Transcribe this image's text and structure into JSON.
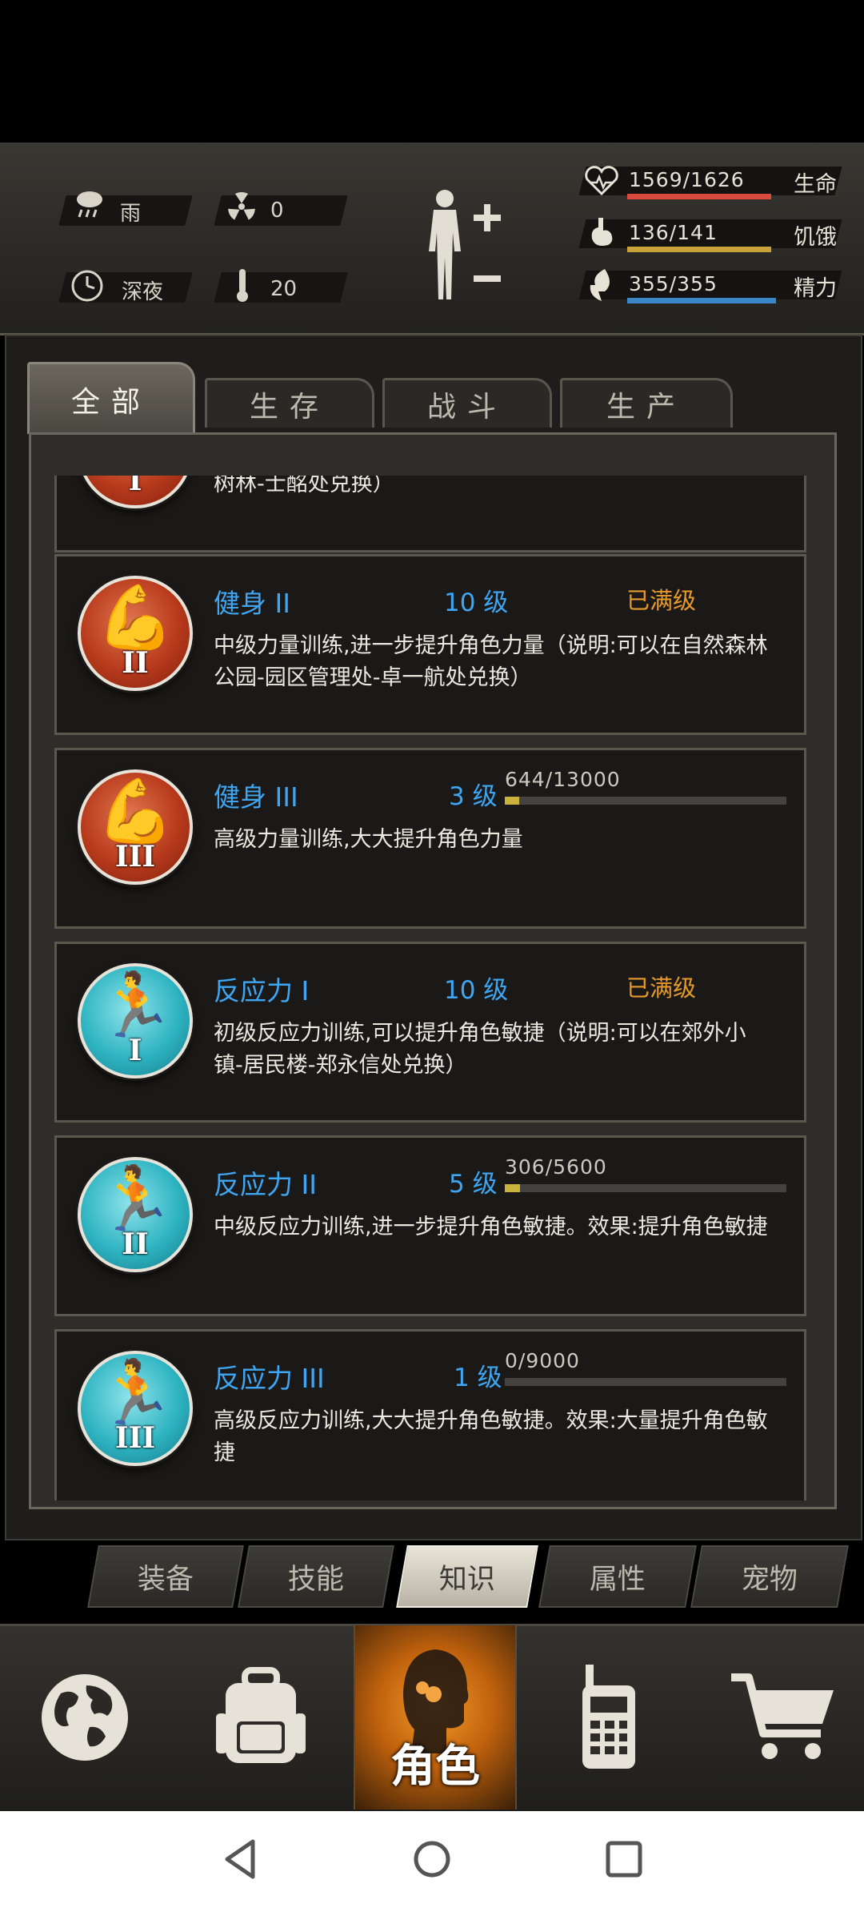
{
  "status": {
    "weather": "雨",
    "radiation": "0",
    "time_of_day": "深夜",
    "temperature": "20",
    "icons": [
      "rain-cloud-icon",
      "radiation-icon",
      "clock-icon",
      "thermometer-icon",
      "body-figure-icon",
      "heart-icon",
      "stomach-icon",
      "energy-icon"
    ]
  },
  "stats": {
    "life": {
      "value": "1569/1626",
      "label": "生命",
      "fraction": 0.965,
      "color": "#d94a3c"
    },
    "hunger": {
      "value": "136/141",
      "label": "饥饿",
      "fraction": 0.965,
      "color": "#c9a23a"
    },
    "energy": {
      "value": "355/355",
      "label": "精力",
      "fraction": 1.0,
      "color": "#3a86c8"
    }
  },
  "tabs": [
    "全部",
    "生存",
    "战斗",
    "生产"
  ],
  "partial_card": {
    "desc": "树林-士酩处兑换）"
  },
  "skills": [
    {
      "name": "健身 II",
      "level": "10 级",
      "status": "已满级",
      "roman": "II",
      "desc": "中级力量训练,进一步提升角色力量（说明:可以在自然森林公园-园区管理处-卓一航处兑换）"
    },
    {
      "name": "健身 III",
      "level": "3 级",
      "progress": "644/13000",
      "fraction": 0.0495,
      "roman": "III",
      "desc": "高级力量训练,大大提升角色力量"
    },
    {
      "name": "反应力 I",
      "level": "10 级",
      "status": "已满级",
      "roman": "I",
      "desc": "初级反应力训练,可以提升角色敏捷（说明:可以在郊外小镇-居民楼-郑永信处兑换）"
    },
    {
      "name": "反应力 II",
      "level": "5 级",
      "progress": "306/5600",
      "fraction": 0.0546,
      "roman": "II",
      "desc": "中级反应力训练,进一步提升角色敏捷。效果:提升角色敏捷"
    },
    {
      "name": "反应力 III",
      "level": "1 级",
      "progress": "0/9000",
      "fraction": 0.0,
      "roman": "III",
      "desc": "高级反应力训练,大大提升角色敏捷。效果:大量提升角色敏捷"
    }
  ],
  "subtabs": [
    "装备",
    "技能",
    "知识",
    "属性",
    "宠物"
  ],
  "nav": {
    "character_label": "角色"
  }
}
